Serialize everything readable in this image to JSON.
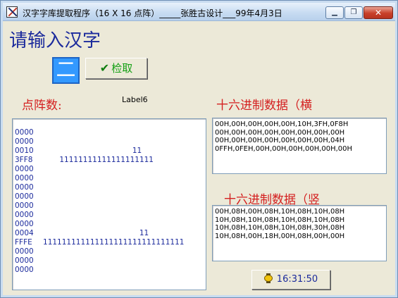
{
  "window": {
    "title": "汉字字库提取程序（16 X 16 点阵）_____张胜古设计___99年4月3日",
    "minimize_glyph": "▁",
    "maximize_glyph": "❐",
    "close_glyph": "✕"
  },
  "heading": "请输入汉字",
  "input_char": "二",
  "fetch_button": {
    "label": "检取",
    "icon": "checkmark-icon"
  },
  "dot_count_label": "点阵数:",
  "label6": "Label6",
  "hex_horizontal_label": "十六进制数据（横",
  "hex_vertical_label": "十六进制数据（竖",
  "dot_matrix": [
    {
      "hex": "0000",
      "bits": ""
    },
    {
      "hex": "0000",
      "bits": ""
    },
    {
      "hex": "0010",
      "bits": "                                         11"
    },
    {
      "hex": "3FF8",
      "bits": "          11111111111111111111"
    },
    {
      "hex": "0000",
      "bits": ""
    },
    {
      "hex": "0000",
      "bits": ""
    },
    {
      "hex": "0000",
      "bits": ""
    },
    {
      "hex": "0000",
      "bits": ""
    },
    {
      "hex": "0000",
      "bits": ""
    },
    {
      "hex": "0000",
      "bits": ""
    },
    {
      "hex": "0000",
      "bits": ""
    },
    {
      "hex": "0004",
      "bits": "                                            11"
    },
    {
      "hex": "FFFE",
      "bits": "   111111111111111111111111111111"
    },
    {
      "hex": "0000",
      "bits": ""
    },
    {
      "hex": "0000",
      "bits": ""
    },
    {
      "hex": "0000",
      "bits": ""
    }
  ],
  "hex_horizontal": [
    "00H,00H,00H,00H,00H,10H,3FH,0F8H",
    "00H,00H,00H,00H,00H,00H,00H,00H",
    "00H,00H,00H,00H,00H,00H,00H,04H",
    "0FFH,0FEH,00H,00H,00H,00H,00H,00H"
  ],
  "hex_vertical": [
    "00H,08H,00H,08H,10H,08H,10H,08H",
    "10H,08H,10H,08H,10H,08H,10H,08H",
    "10H,08H,10H,08H,10H,08H,30H,08H",
    "10H,08H,00H,18H,00H,08H,00H,00H"
  ],
  "time_button": {
    "label": "16:31:50",
    "icon": "stopwatch-icon"
  }
}
